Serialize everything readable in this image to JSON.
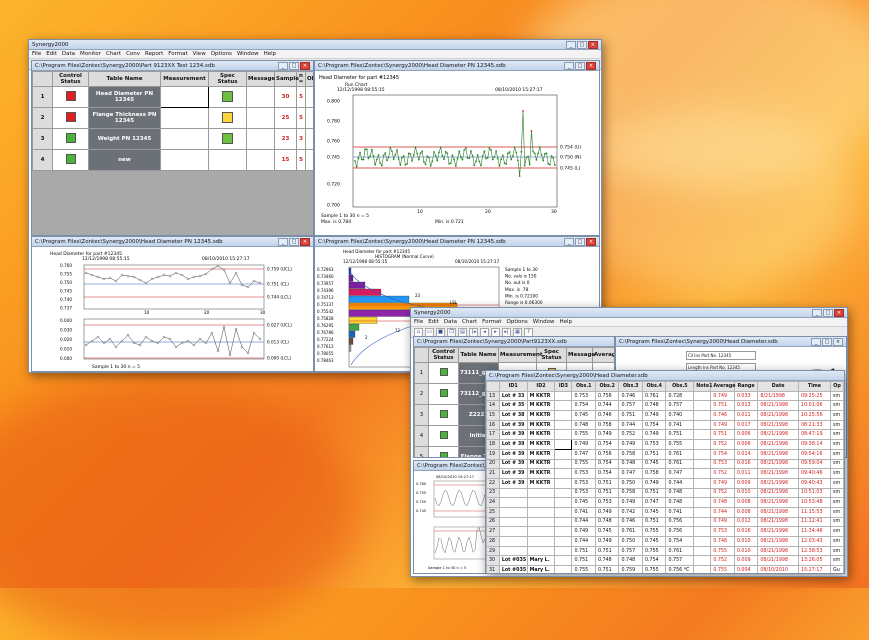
{
  "app": {
    "title": "Synergy2000",
    "menu": [
      "File",
      "Edit",
      "Data",
      "Monitor",
      "Chart",
      "Conv",
      "Report",
      "Format",
      "View",
      "Options",
      "Window",
      "Help"
    ],
    "toolbar_icons": [
      "new-icon",
      "open-icon",
      "save-icon",
      "copy-icon",
      "print-icon",
      "first-icon",
      "prev-icon",
      "next-icon",
      "last-icon",
      "chart-icon",
      "help-icon"
    ]
  },
  "sheet_win": {
    "title": "C:\\Program Files\\Zontec\\Synergy2000\\Part 9123XX Test 1234.sdb",
    "headers": [
      "",
      "Control Status",
      "Table Name",
      "Measurement",
      "Spec Status",
      "Message",
      "Sample",
      "n =",
      "Obs"
    ],
    "rows": [
      {
        "num": "1",
        "name": "Head Diameter PN 12345",
        "ctl": "#e02020",
        "spec": "#6cc23f",
        "sample": "30",
        "n": "5"
      },
      {
        "num": "2",
        "name": "Flange Thickness PN 12345",
        "ctl": "#e02020",
        "spec": "#ffd33a",
        "sample": "25",
        "n": "5"
      },
      {
        "num": "3",
        "name": "Weight PN 12345",
        "ctl": "#4ab33a",
        "spec": "#6cc23f",
        "sample": "23",
        "n": "3"
      },
      {
        "num": "4",
        "name": "new",
        "ctl": "#4ab33a",
        "spec": "",
        "sample": "15",
        "n": "5"
      }
    ]
  },
  "run_win": {
    "title": "C:\\Program Files\\Zontec\\Synergy2000\\Head Diameter PN 12345.sdb",
    "label": "Head Diameter for part #12345",
    "sub": "Run Chart",
    "date_l": "12/12/1998 08:55:15",
    "date_r": "08/10/2010 15:27:17",
    "yticks": [
      "0.800",
      "0.780",
      "0.760",
      "0.745",
      "0.720",
      "0.700"
    ],
    "right": [
      "0.754 (U)",
      "0.750 (N)",
      "0.745 (L)"
    ],
    "foot": [
      "Sample 1 to 30 n = 5",
      "Max. is 0.784",
      "Min. is 0.721"
    ],
    "xticks": [
      "10",
      "20",
      "30"
    ]
  },
  "xbar_win": {
    "title": "C:\\Program Files\\Zontec\\Synergy2000\\Head Diameter PN 12345.sdb",
    "label": "Head Diameter for part #12345",
    "date_l": "12/12/1998 08:55:15",
    "date_r": "08/10/2010 15:27:17",
    "xbar_y": [
      "0.760",
      "0.755",
      "0.750",
      "0.745",
      "0.740",
      "0.737"
    ],
    "xbar_r": [
      "0.759 (UCL)",
      "0.751 (CL)",
      "0.744 (LCL)"
    ],
    "r_y": [
      "0.040",
      "0.030",
      "0.020",
      "0.010",
      "0.000"
    ],
    "r_r": [
      "0.027 (UCL)",
      "0.013 (CL)",
      "0.000 (LCL)"
    ],
    "foot": "Sample 1 to 30 n = 5",
    "xticks": [
      "10",
      "20",
      "30"
    ]
  },
  "hist_win": {
    "title": "C:\\Program Files\\Zontec\\Synergy2000\\Head Diameter PN 12345.sdb",
    "label": "Head Diameter for part #12345",
    "sub": "HISTOGRAM (Normal Curve)",
    "date_l": "12/12/1998 08:55:15",
    "date_r": "08/10/2010 15:27:17",
    "bins": [
      "0.72963",
      "0.73460",
      "0.73957",
      "0.74396",
      "0.74713",
      "0.75137",
      "0.75542",
      "0.75828",
      "0.76295",
      "0.76786",
      "0.77224",
      "0.77613",
      "0.78055",
      "0.78463"
    ],
    "stats": [
      "Sample 1 to 30",
      "No. vals is 150",
      "No. out is 0",
      "Max. is .78",
      "Min. is 0.72100",
      "Range is 0.06300",
      "Width is 0.00416",
      "Skew is 0.73050",
      "Mode is 0.75450",
      "Average is 0.75131",
      "Range is 0.06300",
      "Skewness is 0.0607",
      "Std.dev is 0.01618",
      "Kurtosis is 3.4403",
      "Cpk is 0.4871"
    ],
    "bar_labels": [
      "LSL",
      "NOM",
      "47",
      "23",
      "12",
      "2"
    ]
  },
  "front_win": {
    "title": "Synergy2000",
    "menu": [
      "File",
      "Edit",
      "Data",
      "Chart",
      "Format",
      "Options",
      "Window",
      "Help"
    ],
    "sheet_title": "C:\\Program Files\\Zontec\\Synergy2000\\Part9123XX.sdb",
    "right_title": "C:\\Program Files\\Zontec\\Synergy2000\\Head Diameter.sdb",
    "sheet_headers": [
      "Control Status",
      "Table Name",
      "Measurement",
      "Spec Status",
      "Message",
      "Average",
      "Data"
    ],
    "sheet_rows": [
      "1",
      "2",
      "3",
      "4",
      "5",
      "6",
      "7"
    ],
    "sheet_names": [
      "73111_gdddd",
      "73112_gdddd",
      "Z2222",
      "Initial",
      "Flange Thic",
      "Head Diam",
      "Weight"
    ],
    "legend": [
      "Cil Ins Part No. 12345",
      "Length Ins Part No. 12345",
      "Cil Ins Part No. 12345",
      "Length Ins Part No. 12345",
      "OD Ins Part No. 12345",
      "Ins Part No. 12345"
    ],
    "grid_headers": [
      "",
      "ID1",
      "ID2",
      "ID3",
      "Obs.1",
      "Obs.2",
      "Obs.3",
      "Obs.4",
      "Obs.5",
      "Note1",
      "Average",
      "Range",
      "Date",
      "Time",
      "Op"
    ],
    "grid_rows": [
      [
        "13",
        "Lot # 33",
        "M KKTR",
        "",
        "0.753",
        "0.756",
        "0.746",
        "0.761",
        "0.728",
        "",
        "0.749",
        "0.033",
        "8/21/1998",
        "09:25:25",
        "sm"
      ],
      [
        "14",
        "Lot # 35",
        "M KKTR",
        "",
        "0.754",
        "0.744",
        "0.757",
        "0.748",
        "0.757",
        "",
        "0.751",
        "0.013",
        "08/21/1998",
        "10:01:06",
        "sm"
      ],
      [
        "15",
        "Lot # 38",
        "M KKTR",
        "",
        "0.745",
        "0.746",
        "0.751",
        "0.749",
        "0.740",
        "",
        "0.746",
        "0.011",
        "08/21/1998",
        "10:25:56",
        "sm"
      ],
      [
        "16",
        "Lot # 39",
        "M KKTR",
        "",
        "0.748",
        "0.758",
        "0.744",
        "0.754",
        "0.741",
        "",
        "0.749",
        "0.017",
        "08/21/1998",
        "08:21:33",
        "sm"
      ],
      [
        "17",
        "Lot # 39",
        "M KKTR",
        "",
        "0.755",
        "0.749",
        "0.752",
        "0.749",
        "0.751",
        "",
        "0.751",
        "0.006",
        "08/21/1998",
        "08:47:19",
        "sm"
      ],
      [
        "18",
        "Lot # 39",
        "M KKTR",
        "",
        "0.749",
        "0.754",
        "0.749",
        "0.753",
        "0.755",
        "",
        "0.752",
        "0.006",
        "08/21/1998",
        "09:38:14",
        "sm"
      ],
      [
        "19",
        "Lot # 39",
        "M KKTR",
        "",
        "0.747",
        "0.756",
        "0.758",
        "0.751",
        "0.761",
        "",
        "0.754",
        "0.014",
        "08/21/1998",
        "09:54:16",
        "sm"
      ],
      [
        "20",
        "Lot # 39",
        "M KKTR",
        "",
        "0.755",
        "0.754",
        "0.748",
        "0.745",
        "0.761",
        "",
        "0.753",
        "0.016",
        "08/21/1998",
        "09:59:04",
        "sm"
      ],
      [
        "21",
        "Lot # 39",
        "M KKTR",
        "",
        "0.753",
        "0.754",
        "0.747",
        "0.758",
        "0.747",
        "",
        "0.752",
        "0.011",
        "08/21/1998",
        "09:40:46",
        "sm"
      ],
      [
        "22",
        "Lot # 39",
        "M KKTR",
        "",
        "0.753",
        "0.751",
        "0.750",
        "0.749",
        "0.744",
        "",
        "0.749",
        "0.009",
        "08/21/1998",
        "09:40:43",
        "sm"
      ],
      [
        "23",
        "",
        "",
        "",
        "0.753",
        "0.751",
        "0.758",
        "0.751",
        "0.748",
        "",
        "0.752",
        "0.010",
        "08/21/1998",
        "10:51:03",
        "sm"
      ],
      [
        "24",
        "",
        "",
        "",
        "0.745",
        "0.753",
        "0.749",
        "0.747",
        "0.748",
        "",
        "0.748",
        "0.008",
        "08/21/1998",
        "10:53:48",
        "sm"
      ],
      [
        "25",
        "",
        "",
        "",
        "0.741",
        "0.749",
        "0.742",
        "0.745",
        "0.741",
        "",
        "0.744",
        "0.008",
        "08/21/1998",
        "11:15:53",
        "sm"
      ],
      [
        "26",
        "",
        "",
        "",
        "0.744",
        "0.748",
        "0.746",
        "0.751",
        "0.756",
        "",
        "0.749",
        "0.012",
        "08/21/1998",
        "11:12:41",
        "sm"
      ],
      [
        "27",
        "",
        "",
        "",
        "0.749",
        "0.745",
        "0.761",
        "0.755",
        "0.756",
        "",
        "0.753",
        "0.016",
        "08/21/1998",
        "11:34:46",
        "sm"
      ],
      [
        "28",
        "",
        "",
        "",
        "0.744",
        "0.749",
        "0.750",
        "0.745",
        "0.754",
        "",
        "0.748",
        "0.010",
        "08/21/1998",
        "12:03:43",
        "sm"
      ],
      [
        "29",
        "",
        "",
        "",
        "0.751",
        "0.751",
        "0.757",
        "0.755",
        "0.761",
        "",
        "0.755",
        "0.010",
        "08/21/1998",
        "12:38:53",
        "sm"
      ],
      [
        "30",
        "Lot #035",
        "Mary L.",
        "",
        "0.751",
        "0.748",
        "0.748",
        "0.754",
        "0.757",
        "",
        "0.752",
        "0.009",
        "08/21/1998",
        "13:26:05",
        "sm"
      ],
      [
        "31",
        "Lot #035",
        "Mary L.",
        "",
        "0.755",
        "0.751",
        "0.759",
        "0.755",
        "0.756 *C",
        "",
        "0.755",
        "0.004",
        "08/10/2010",
        "15:27:17",
        "Gu"
      ]
    ],
    "small_chart_y": [
      "0.760",
      "0.755",
      "0.750",
      "0.745"
    ],
    "small_date": "08/10/2010 15:27:17",
    "small_foot": "Sample 1 to 30 n = 5",
    "cards": "cards"
  }
}
